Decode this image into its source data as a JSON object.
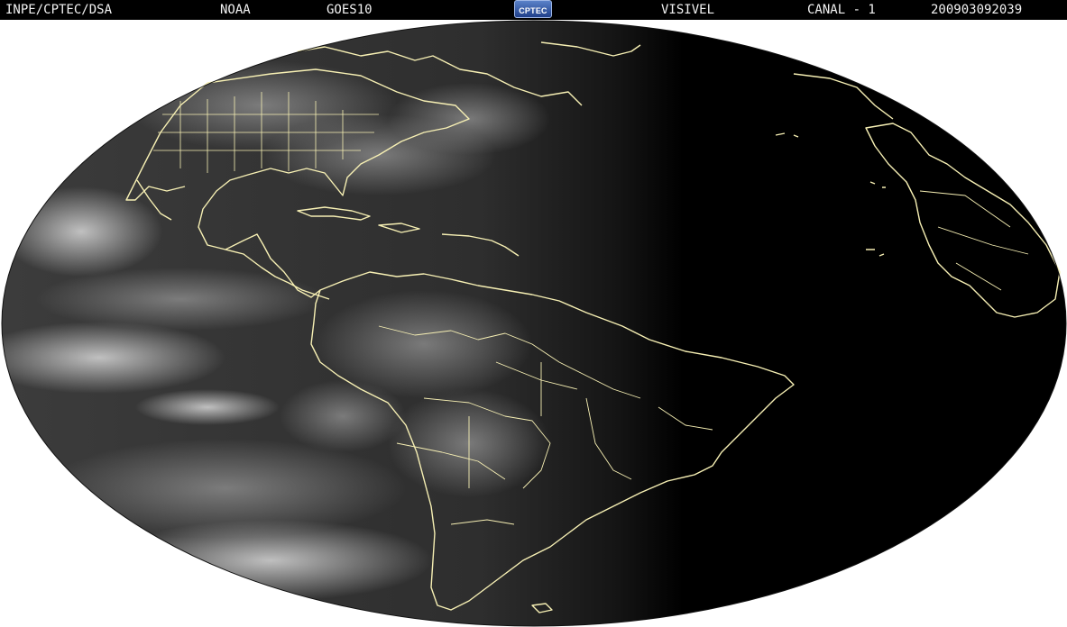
{
  "header": {
    "organization": "INPE/CPTEC/DSA",
    "agency": "NOAA",
    "satellite": "GOES10",
    "band": "VISIVEL",
    "channel": "CANAL - 1",
    "timestamp": "200903092039"
  },
  "logo": {
    "text": "CPTEC",
    "icon": "cptec-logo"
  },
  "colors": {
    "header_background": "#000000",
    "header_text": "#f2f2f2",
    "page_background": "#ffffff",
    "disc_night": "#000000",
    "disc_day": "#3a3a3a",
    "coastlines": "#f7f0b4"
  }
}
